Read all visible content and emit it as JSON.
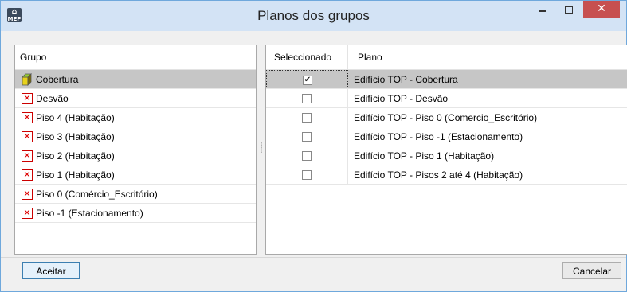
{
  "window": {
    "title": "Planos dos grupos",
    "app_icon_text": "MEP",
    "close_glyph": "✕"
  },
  "left": {
    "header": "Grupo",
    "items": [
      {
        "label": "Cobertura",
        "icon": "cube-icon",
        "selected": true
      },
      {
        "label": "Desvão",
        "icon": "red-x-icon",
        "selected": false
      },
      {
        "label": "Piso 4 (Habitação)",
        "icon": "red-x-icon",
        "selected": false
      },
      {
        "label": "Piso 3 (Habitação)",
        "icon": "red-x-icon",
        "selected": false
      },
      {
        "label": "Piso 2 (Habitação)",
        "icon": "red-x-icon",
        "selected": false
      },
      {
        "label": "Piso 1 (Habitação)",
        "icon": "red-x-icon",
        "selected": false
      },
      {
        "label": "Piso 0 (Comércio_Escritório)",
        "icon": "red-x-icon",
        "selected": false
      },
      {
        "label": "Piso -1 (Estacionamento)",
        "icon": "red-x-icon",
        "selected": false
      }
    ]
  },
  "right": {
    "col_selected": "Seleccionado",
    "col_plano": "Plano",
    "rows": [
      {
        "plano": "Edifício TOP - Cobertura",
        "checked": true,
        "mark": "✔"
      },
      {
        "plano": "Edifício TOP - Desvão",
        "checked": false,
        "mark": ""
      },
      {
        "plano": "Edifício TOP - Piso 0 (Comercio_Escritório)",
        "checked": false,
        "mark": ""
      },
      {
        "plano": "Edifício TOP - Piso -1 (Estacionamento)",
        "checked": false,
        "mark": ""
      },
      {
        "plano": "Edifício TOP - Piso 1 (Habitação)",
        "checked": false,
        "mark": ""
      },
      {
        "plano": "Edifício TOP - Pisos 2 até 4 (Habitação)",
        "checked": false,
        "mark": ""
      }
    ]
  },
  "buttons": {
    "accept": "Aceitar",
    "cancel": "Cancelar"
  },
  "colors": {
    "titlebar": "#d3e3f5",
    "close": "#c75050",
    "selection": "#c6c6c6",
    "x_icon": "#d00000"
  }
}
